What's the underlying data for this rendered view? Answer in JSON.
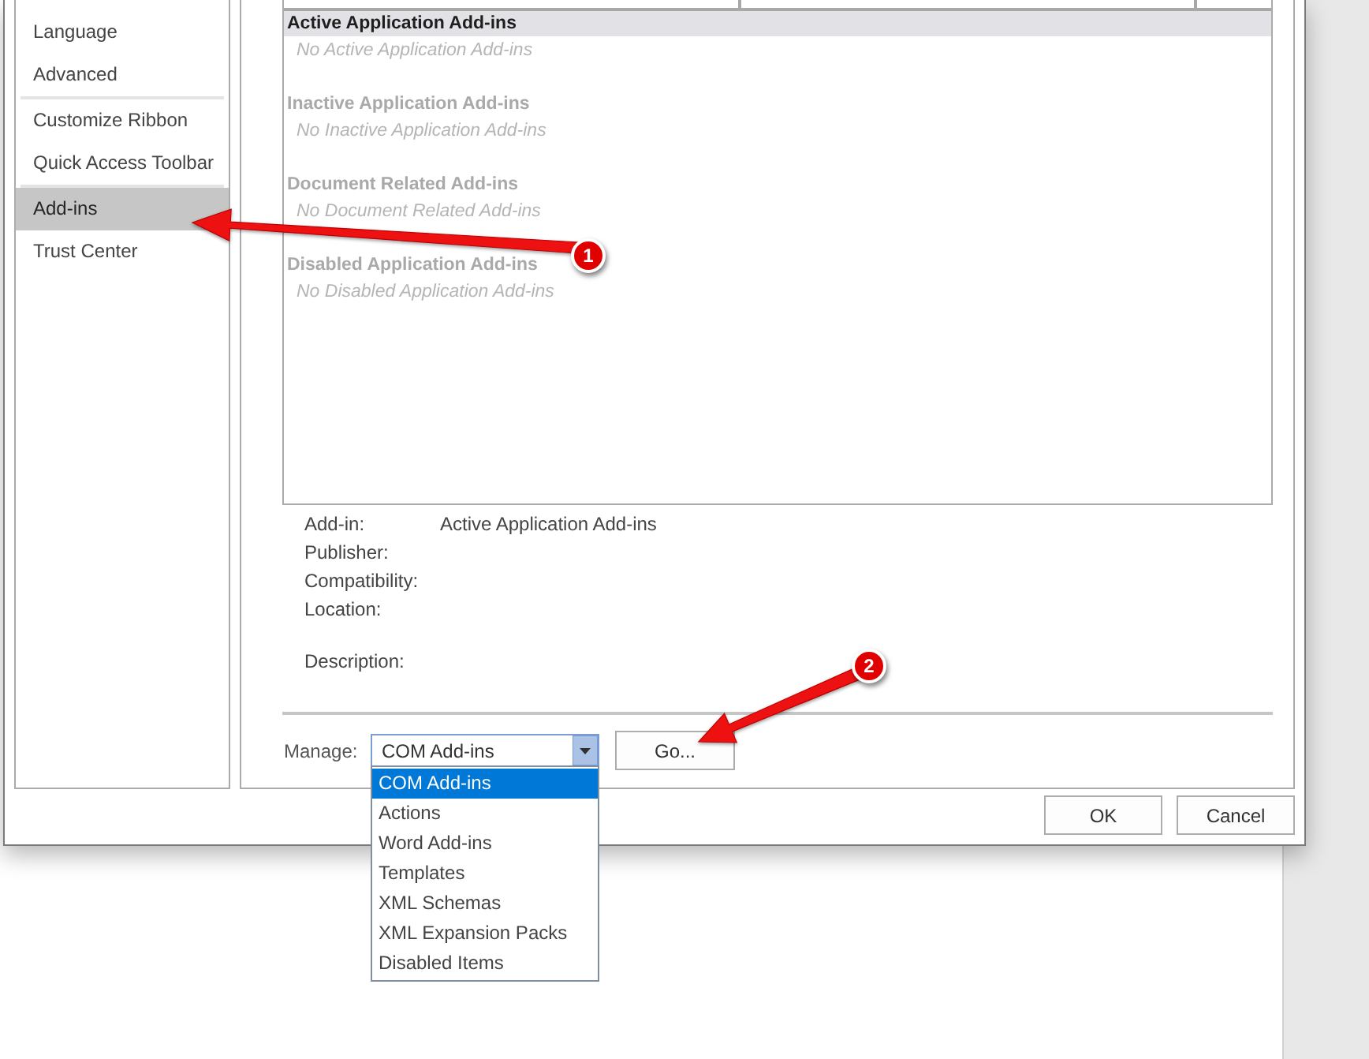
{
  "sidebar": {
    "groups": [
      {
        "items": [
          {
            "label": "Language",
            "selected": false
          },
          {
            "label": "Advanced",
            "selected": false
          }
        ]
      },
      {
        "items": [
          {
            "label": "Customize Ribbon",
            "selected": false
          },
          {
            "label": "Quick Access Toolbar",
            "selected": false
          }
        ]
      },
      {
        "items": [
          {
            "label": "Add-ins",
            "selected": true
          },
          {
            "label": "Trust Center",
            "selected": false
          }
        ]
      }
    ]
  },
  "addins_list": {
    "groups": [
      {
        "heading": "Active Application Add-ins",
        "selected": true,
        "empty_note": "No Active Application Add-ins"
      },
      {
        "heading": "Inactive Application Add-ins",
        "selected": false,
        "empty_note": "No Inactive Application Add-ins"
      },
      {
        "heading": "Document Related Add-ins",
        "selected": false,
        "empty_note": "No Document Related Add-ins"
      },
      {
        "heading": "Disabled Application Add-ins",
        "selected": false,
        "empty_note": "No Disabled Application Add-ins"
      }
    ]
  },
  "details": {
    "fields": [
      {
        "label": "Add-in:",
        "value": "Active Application Add-ins"
      },
      {
        "label": "Publisher:"
      },
      {
        "label": "Compatibility:"
      },
      {
        "label": "Location:"
      }
    ],
    "description": {
      "label": "Description:"
    }
  },
  "manage": {
    "label": "Manage:",
    "value": "COM Add-ins",
    "open": true,
    "options": [
      {
        "label": "COM Add-ins",
        "selected": true
      },
      {
        "label": "Actions",
        "selected": false
      },
      {
        "label": "Word Add-ins",
        "selected": false
      },
      {
        "label": "Templates",
        "selected": false
      },
      {
        "label": "XML Schemas",
        "selected": false
      },
      {
        "label": "XML Expansion Packs",
        "selected": false
      },
      {
        "label": "Disabled Items",
        "selected": false
      }
    ],
    "go_button": {
      "label": "Go..."
    }
  },
  "buttons": [
    "OK",
    "Cancel"
  ],
  "annotations": [
    {
      "number": "1"
    },
    {
      "number": "2"
    }
  ]
}
